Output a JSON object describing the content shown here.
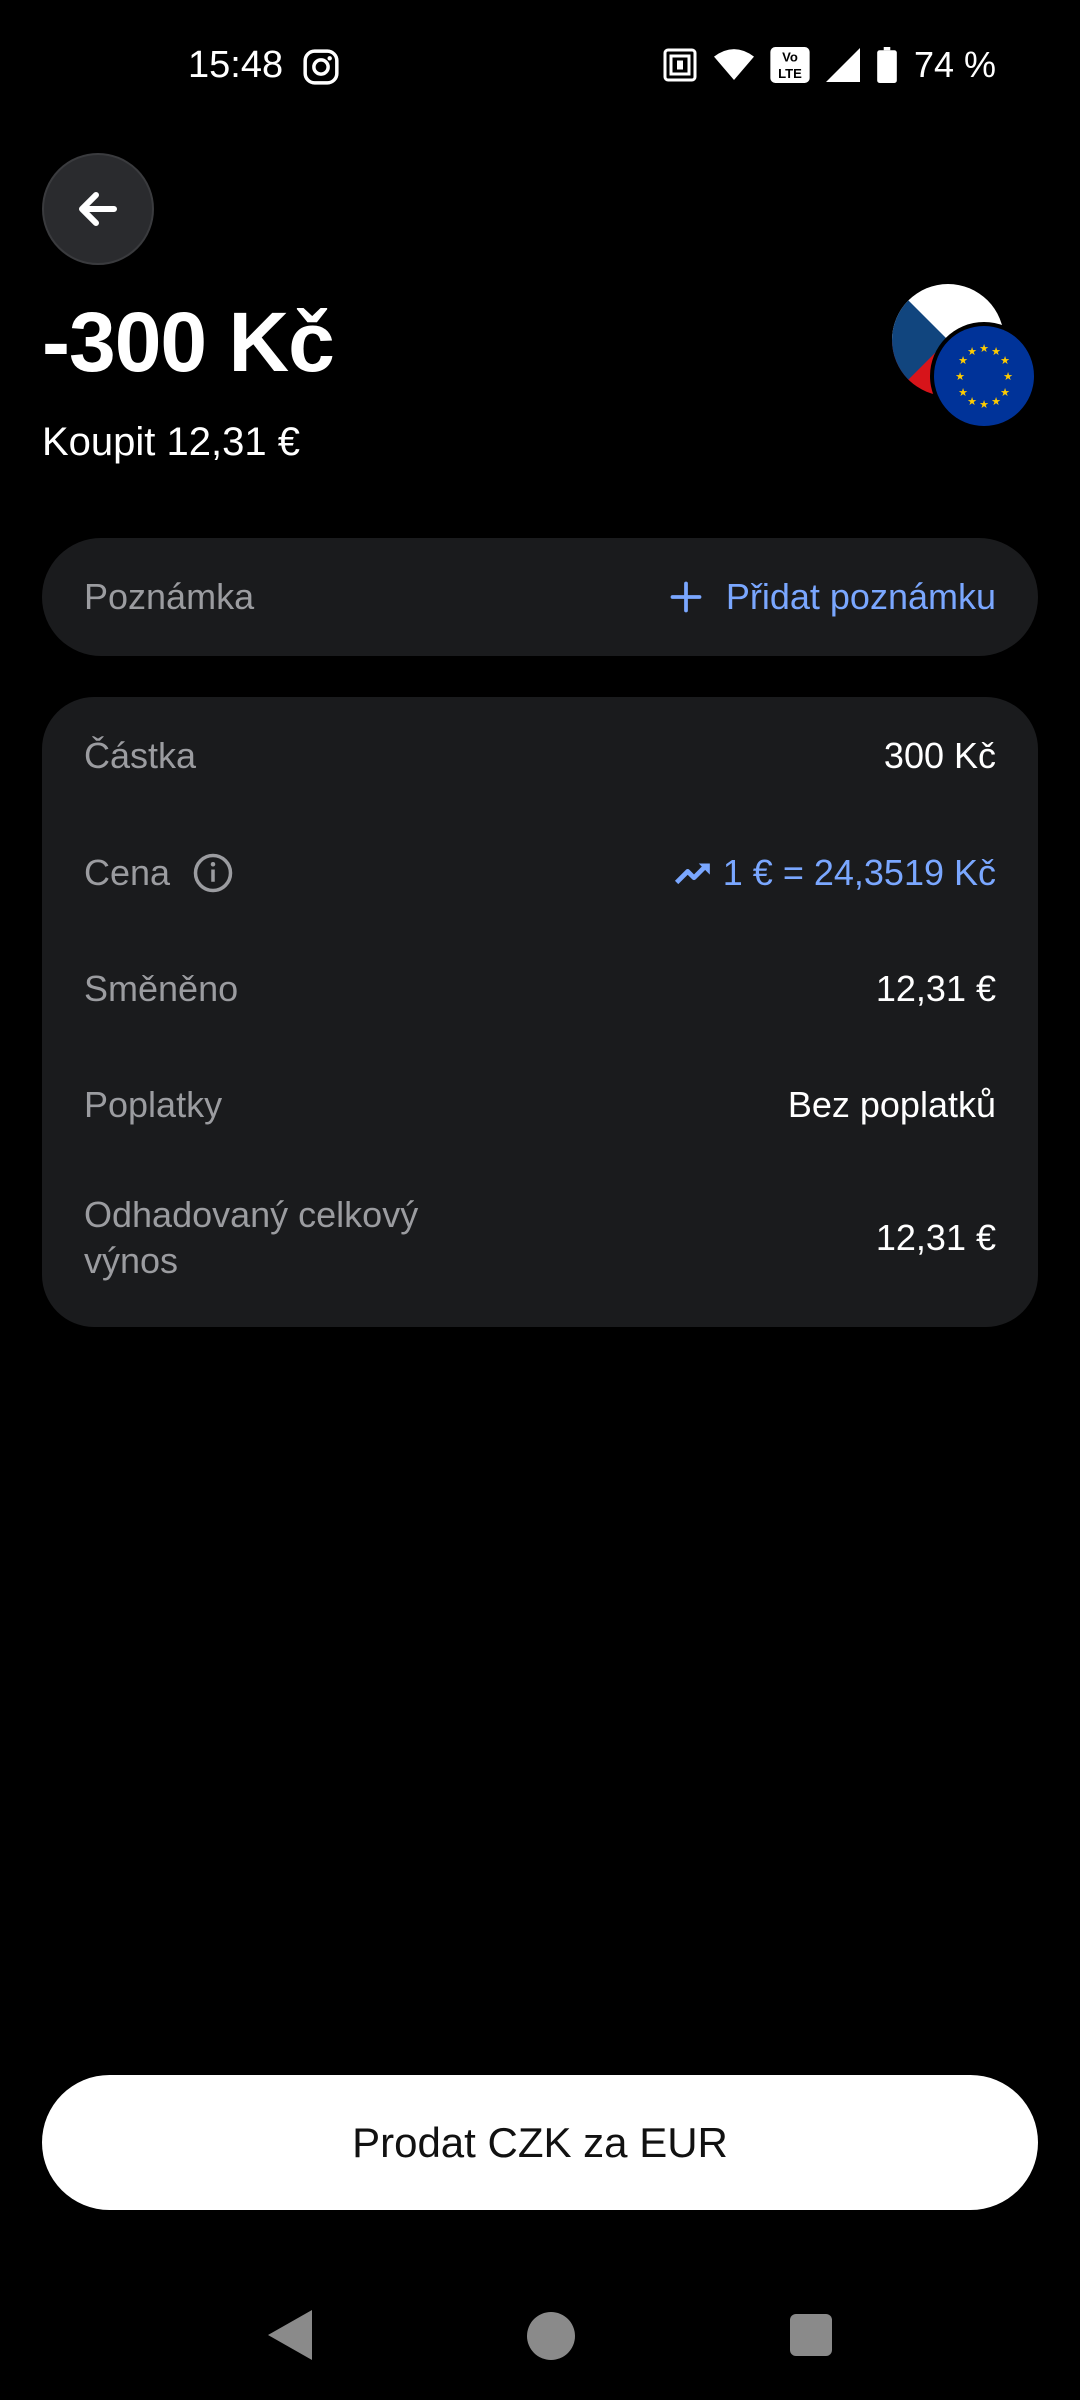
{
  "status_bar": {
    "time": "15:48",
    "battery": "74 %",
    "icons": [
      "instagram-icon",
      "nfc-icon",
      "wifi-icon",
      "volte-icon",
      "signal-icon",
      "battery-icon"
    ],
    "volte_text": "Vo LTE"
  },
  "header": {
    "back_icon": "arrow-left-icon",
    "amount": "-300 Kč",
    "subtitle": "Koupit 12,31 €",
    "flags": [
      "czech-flag-icon",
      "eu-flag-icon"
    ]
  },
  "note": {
    "label": "Poznámka",
    "add_label": "Přidat poznámku",
    "add_icon": "plus-icon"
  },
  "details": {
    "rows": [
      {
        "label": "Částka",
        "value": "300 Kč"
      },
      {
        "label": "Cena",
        "value": "1 € = 24,3519 Kč",
        "icon": "info-icon",
        "value_icon": "trending-up-icon"
      },
      {
        "label": "Směněno",
        "value": "12,31 €"
      },
      {
        "label": "Poplatky",
        "value": "Bez poplatků"
      },
      {
        "label": "Odhadovaný celkový výnos",
        "value": "12,31 €"
      }
    ]
  },
  "cta": {
    "label": "Prodat CZK za EUR"
  },
  "nav": {
    "icons": [
      "nav-back-icon",
      "nav-home-icon",
      "nav-recents-icon"
    ]
  },
  "colors": {
    "background": "#000000",
    "card": "#1a1b1d",
    "accent": "#7aa7ff",
    "muted": "#9b9ca0"
  }
}
